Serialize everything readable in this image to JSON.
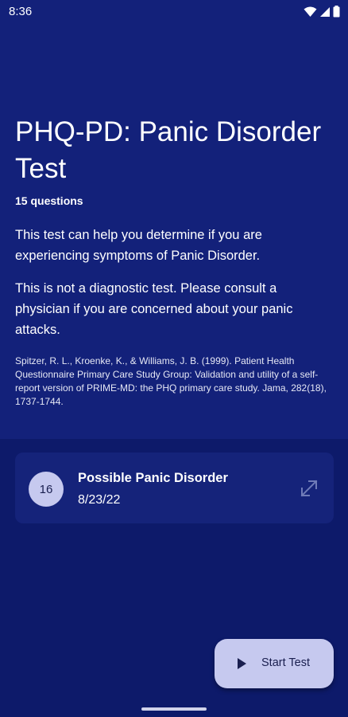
{
  "status_bar": {
    "time": "8:36",
    "icons": [
      "wifi-icon",
      "signal-icon",
      "battery-icon"
    ]
  },
  "header": {
    "title": "PHQ-PD: Panic Disorder Test",
    "question_count": "15 questions"
  },
  "description": {
    "paragraph1": "This test can help you determine if you are experiencing symptoms of Panic Disorder.",
    "paragraph2": "This is not a diagnostic test. Please consult a physician if you are concerned about your panic attacks.",
    "citation": "Spitzer, R. L., Kroenke, K., & Williams, J. B. (1999). Patient Health Questionnaire Primary Care Study Group: Validation and utility of a self-report version of PRIME-MD: the PHQ primary care study. Jama, 282(18), 1737-1744."
  },
  "result": {
    "score": "16",
    "label": "Possible Panic Disorder",
    "date": "8/23/22",
    "action_icon": "expand-icon"
  },
  "actions": {
    "start_label": "Start Test",
    "start_icon": "play-icon"
  },
  "colors": {
    "top_background": "#13217a",
    "bottom_background": "#0d1a6a",
    "accent": "#c6c9ef"
  }
}
